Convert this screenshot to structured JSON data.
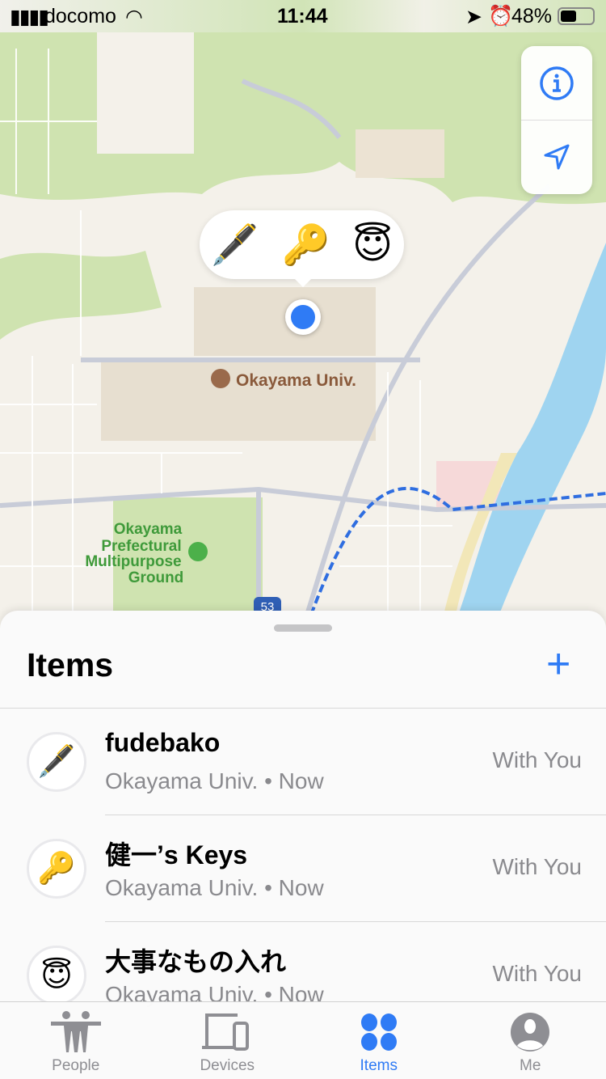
{
  "status_bar": {
    "carrier": "docomo",
    "time": "11:44",
    "battery": "48%",
    "battery_level": 0.48
  },
  "map": {
    "university_label": "Okayama Univ.",
    "park_label_lines": [
      "Okayama",
      "Prefectural",
      "Multipurpose",
      "Ground"
    ],
    "route_shield": "53",
    "bubble_emojis": [
      "🖋️",
      "🔑",
      "😇"
    ]
  },
  "sheet": {
    "title": "Items",
    "add_label": "+"
  },
  "items": [
    {
      "emoji": "🖋️",
      "name": "fudebako",
      "location": "Okayama Univ. • Now",
      "status": "With You"
    },
    {
      "emoji": "🔑",
      "name": "健一’s Keys",
      "location": "Okayama Univ. • Now",
      "status": "With You"
    },
    {
      "emoji": "😇",
      "name": "大事なもの入れ",
      "location": "Okayama Univ. • Now",
      "status": "With You"
    }
  ],
  "tabs": [
    {
      "label": "People"
    },
    {
      "label": "Devices"
    },
    {
      "label": "Items",
      "active": true
    },
    {
      "label": "Me"
    }
  ],
  "colors": {
    "accent": "#2f7bf5",
    "inactive": "#8e8e93"
  }
}
